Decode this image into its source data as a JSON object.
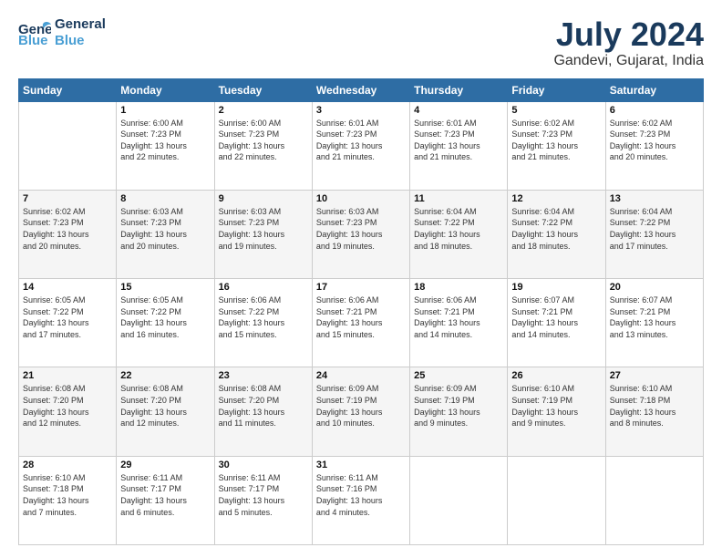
{
  "logo": {
    "line1": "General",
    "line2": "Blue"
  },
  "title": "July 2024",
  "subtitle": "Gandevi, Gujarat, India",
  "days_header": [
    "Sunday",
    "Monday",
    "Tuesday",
    "Wednesday",
    "Thursday",
    "Friday",
    "Saturday"
  ],
  "weeks": [
    [
      {
        "num": "",
        "text": ""
      },
      {
        "num": "1",
        "text": "Sunrise: 6:00 AM\nSunset: 7:23 PM\nDaylight: 13 hours\nand 22 minutes."
      },
      {
        "num": "2",
        "text": "Sunrise: 6:00 AM\nSunset: 7:23 PM\nDaylight: 13 hours\nand 22 minutes."
      },
      {
        "num": "3",
        "text": "Sunrise: 6:01 AM\nSunset: 7:23 PM\nDaylight: 13 hours\nand 21 minutes."
      },
      {
        "num": "4",
        "text": "Sunrise: 6:01 AM\nSunset: 7:23 PM\nDaylight: 13 hours\nand 21 minutes."
      },
      {
        "num": "5",
        "text": "Sunrise: 6:02 AM\nSunset: 7:23 PM\nDaylight: 13 hours\nand 21 minutes."
      },
      {
        "num": "6",
        "text": "Sunrise: 6:02 AM\nSunset: 7:23 PM\nDaylight: 13 hours\nand 20 minutes."
      }
    ],
    [
      {
        "num": "7",
        "text": "Sunrise: 6:02 AM\nSunset: 7:23 PM\nDaylight: 13 hours\nand 20 minutes."
      },
      {
        "num": "8",
        "text": "Sunrise: 6:03 AM\nSunset: 7:23 PM\nDaylight: 13 hours\nand 20 minutes."
      },
      {
        "num": "9",
        "text": "Sunrise: 6:03 AM\nSunset: 7:23 PM\nDaylight: 13 hours\nand 19 minutes."
      },
      {
        "num": "10",
        "text": "Sunrise: 6:03 AM\nSunset: 7:23 PM\nDaylight: 13 hours\nand 19 minutes."
      },
      {
        "num": "11",
        "text": "Sunrise: 6:04 AM\nSunset: 7:22 PM\nDaylight: 13 hours\nand 18 minutes."
      },
      {
        "num": "12",
        "text": "Sunrise: 6:04 AM\nSunset: 7:22 PM\nDaylight: 13 hours\nand 18 minutes."
      },
      {
        "num": "13",
        "text": "Sunrise: 6:04 AM\nSunset: 7:22 PM\nDaylight: 13 hours\nand 17 minutes."
      }
    ],
    [
      {
        "num": "14",
        "text": "Sunrise: 6:05 AM\nSunset: 7:22 PM\nDaylight: 13 hours\nand 17 minutes."
      },
      {
        "num": "15",
        "text": "Sunrise: 6:05 AM\nSunset: 7:22 PM\nDaylight: 13 hours\nand 16 minutes."
      },
      {
        "num": "16",
        "text": "Sunrise: 6:06 AM\nSunset: 7:22 PM\nDaylight: 13 hours\nand 15 minutes."
      },
      {
        "num": "17",
        "text": "Sunrise: 6:06 AM\nSunset: 7:21 PM\nDaylight: 13 hours\nand 15 minutes."
      },
      {
        "num": "18",
        "text": "Sunrise: 6:06 AM\nSunset: 7:21 PM\nDaylight: 13 hours\nand 14 minutes."
      },
      {
        "num": "19",
        "text": "Sunrise: 6:07 AM\nSunset: 7:21 PM\nDaylight: 13 hours\nand 14 minutes."
      },
      {
        "num": "20",
        "text": "Sunrise: 6:07 AM\nSunset: 7:21 PM\nDaylight: 13 hours\nand 13 minutes."
      }
    ],
    [
      {
        "num": "21",
        "text": "Sunrise: 6:08 AM\nSunset: 7:20 PM\nDaylight: 13 hours\nand 12 minutes."
      },
      {
        "num": "22",
        "text": "Sunrise: 6:08 AM\nSunset: 7:20 PM\nDaylight: 13 hours\nand 12 minutes."
      },
      {
        "num": "23",
        "text": "Sunrise: 6:08 AM\nSunset: 7:20 PM\nDaylight: 13 hours\nand 11 minutes."
      },
      {
        "num": "24",
        "text": "Sunrise: 6:09 AM\nSunset: 7:19 PM\nDaylight: 13 hours\nand 10 minutes."
      },
      {
        "num": "25",
        "text": "Sunrise: 6:09 AM\nSunset: 7:19 PM\nDaylight: 13 hours\nand 9 minutes."
      },
      {
        "num": "26",
        "text": "Sunrise: 6:10 AM\nSunset: 7:19 PM\nDaylight: 13 hours\nand 9 minutes."
      },
      {
        "num": "27",
        "text": "Sunrise: 6:10 AM\nSunset: 7:18 PM\nDaylight: 13 hours\nand 8 minutes."
      }
    ],
    [
      {
        "num": "28",
        "text": "Sunrise: 6:10 AM\nSunset: 7:18 PM\nDaylight: 13 hours\nand 7 minutes."
      },
      {
        "num": "29",
        "text": "Sunrise: 6:11 AM\nSunset: 7:17 PM\nDaylight: 13 hours\nand 6 minutes."
      },
      {
        "num": "30",
        "text": "Sunrise: 6:11 AM\nSunset: 7:17 PM\nDaylight: 13 hours\nand 5 minutes."
      },
      {
        "num": "31",
        "text": "Sunrise: 6:11 AM\nSunset: 7:16 PM\nDaylight: 13 hours\nand 4 minutes."
      },
      {
        "num": "",
        "text": ""
      },
      {
        "num": "",
        "text": ""
      },
      {
        "num": "",
        "text": ""
      }
    ]
  ]
}
